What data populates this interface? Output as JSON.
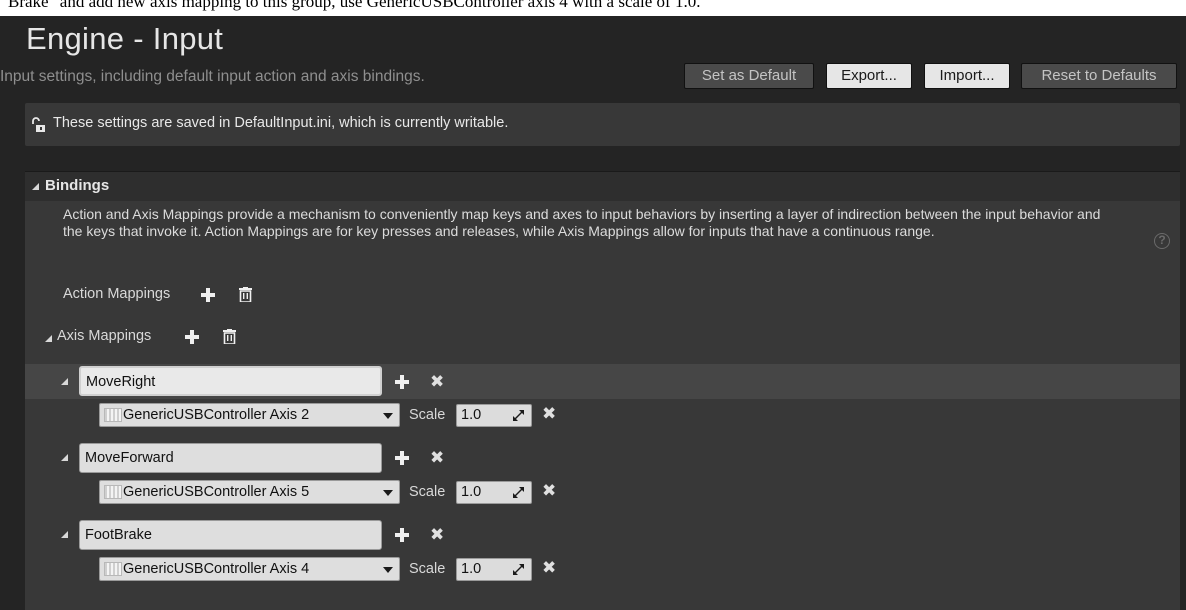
{
  "doc_text": "Brake\" and add new axis mapping to this group, use GenericUSBController axis 4 with a scale of 1.0.",
  "header": {
    "title": "Engine - Input",
    "subtitle": "Input settings, including default input action and axis bindings.",
    "buttons": {
      "set_default": "Set as Default",
      "export": "Export...",
      "import": "Import...",
      "reset": "Reset to Defaults"
    }
  },
  "notice": {
    "text": "These settings are saved in DefaultInput.ini, which is currently writable."
  },
  "bindings": {
    "title": "Bindings",
    "description": "Action and Axis Mappings provide a mechanism to conveniently map keys and axes to input behaviors by inserting a layer of indirection between the input behavior and the keys that invoke it. Action Mappings are for key presses and releases, while Axis Mappings allow for inputs that have a continuous range.",
    "action_mappings_label": "Action Mappings",
    "axis_mappings_label": "Axis Mappings",
    "scale_label": "Scale",
    "axis_mappings": [
      {
        "name": "MoveRight",
        "key": "GenericUSBController Axis 2",
        "scale": "1.0"
      },
      {
        "name": "MoveForward",
        "key": "GenericUSBController Axis 5",
        "scale": "1.0"
      },
      {
        "name": "FootBrake",
        "key": "GenericUSBController Axis 4",
        "scale": "1.0"
      }
    ]
  },
  "colors": {
    "panel_bg": "#242424",
    "section_bg": "#383838",
    "selected_row": "#464646",
    "field_bg": "#dedede"
  }
}
